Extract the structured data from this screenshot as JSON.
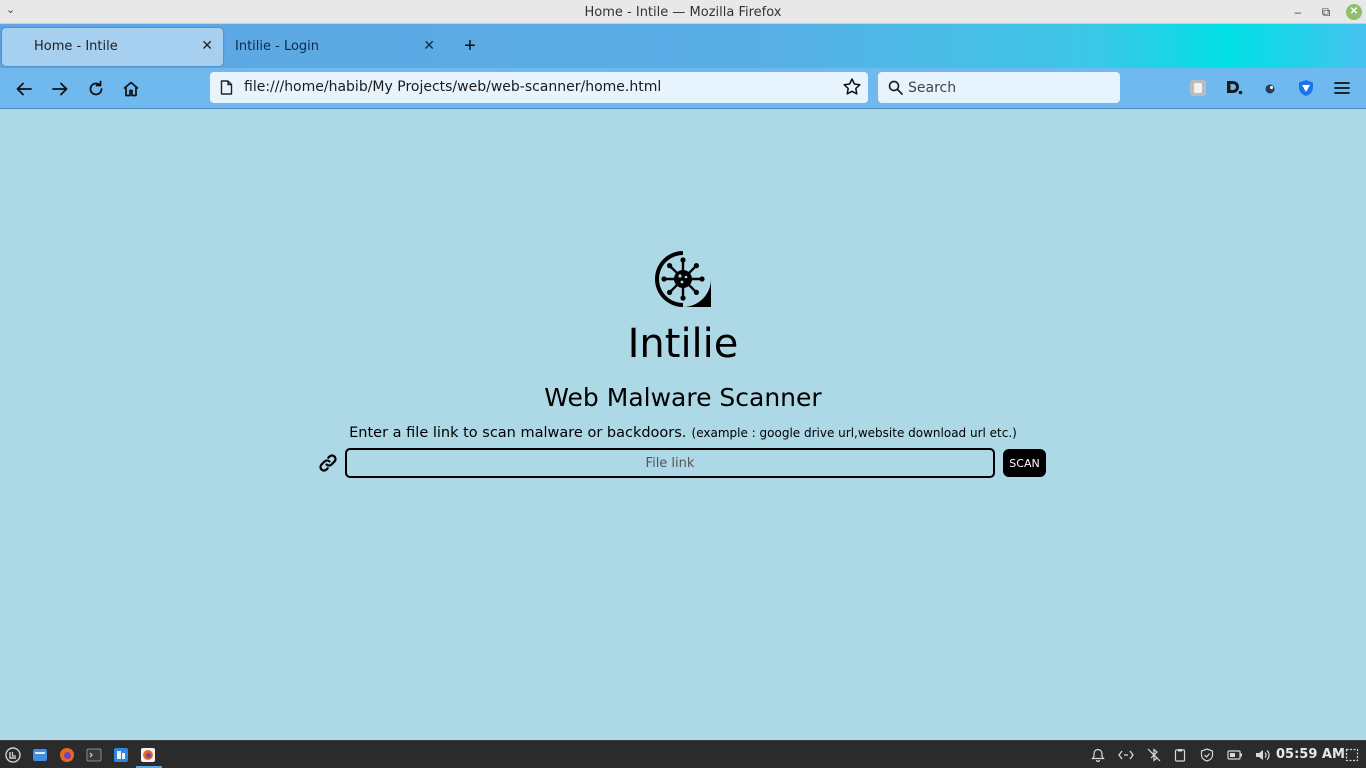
{
  "window": {
    "title": "Home - Intile — Mozilla Firefox"
  },
  "tabs": [
    {
      "label": "Home - Intile",
      "active": true
    },
    {
      "label": "Intilie - Login",
      "active": false
    }
  ],
  "navbar": {
    "url": "file:///home/habib/My Projects/web/web-scanner/home.html",
    "search_placeholder": "Search"
  },
  "page": {
    "title": "Intilie",
    "subtitle": "Web Malware Scanner",
    "instruction_main": "Enter a file link to scan malware or backdoors.",
    "instruction_example": "(example : google drive url,website download url etc.)",
    "input_placeholder": "File link",
    "scan_label": "SCAN"
  },
  "taskbar": {
    "clock": "05:59 AM"
  },
  "colors": {
    "page_background": "#add8e6",
    "scan_button": "#000000",
    "tab_active": "#a6cff0",
    "navbar": "#6fb9ef"
  }
}
